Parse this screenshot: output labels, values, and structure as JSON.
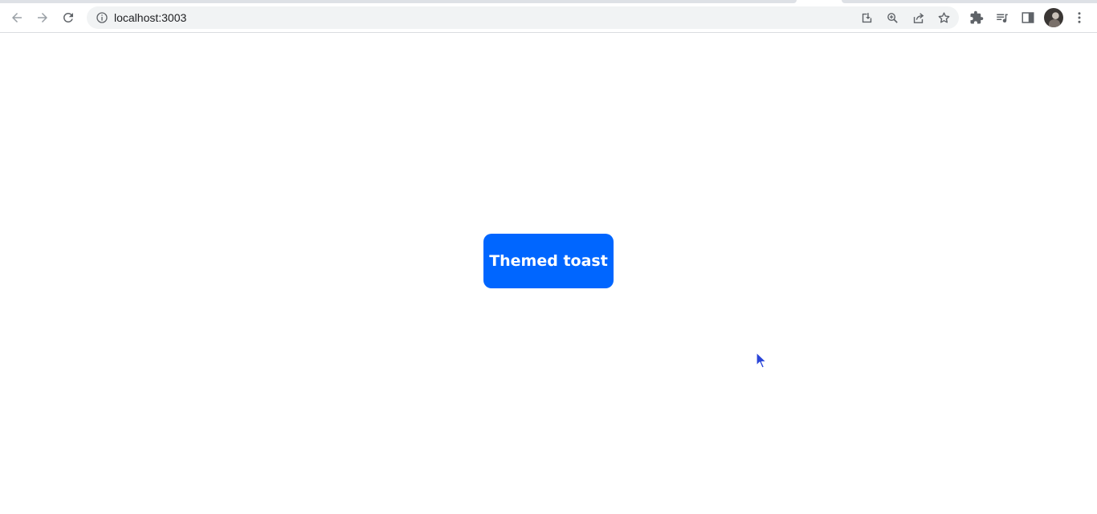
{
  "browser": {
    "url": "localhost:3003",
    "icons": {
      "back": "arrow-left-icon",
      "forward": "arrow-right-icon",
      "reload": "reload-icon",
      "site_info": "info-icon",
      "install": "install-icon",
      "zoom": "zoom-icon",
      "share": "share-icon",
      "bookmark": "star-icon",
      "extensions": "puzzle-icon",
      "media": "media-queue-icon",
      "side_panel": "side-panel-icon",
      "menu": "kebab-menu-icon"
    },
    "colors": {
      "toolbar": "#ffffff",
      "omnibox": "#f1f3f4",
      "icon": "#5f6368",
      "icon_disabled": "#9aa0a6"
    }
  },
  "page": {
    "button_label": "Themed toast",
    "button_color": "#0066ff",
    "button_text_color": "#ffffff"
  }
}
